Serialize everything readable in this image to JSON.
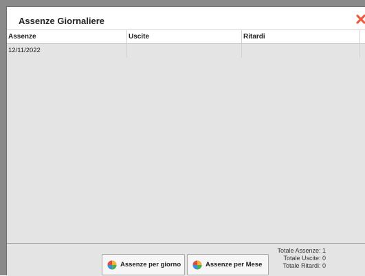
{
  "dialog": {
    "title": "Assenze Giornaliere"
  },
  "table": {
    "columns": [
      "Assenze",
      "Uscite",
      "Ritardi"
    ],
    "rows": [
      [
        "12/11/2022",
        "",
        ""
      ]
    ]
  },
  "footer": {
    "button_day_label": "Assenze per giorno",
    "button_month_label": "Assenze per Mese",
    "total_absences": "Totale Assenze: 1",
    "total_exits": "Totale Uscite: 0",
    "total_late": "Totale Ritardi: 0"
  },
  "icons": {
    "close": "close-icon",
    "chart": "pie-chart-icon"
  },
  "colors": {
    "close": "#ef5a3c",
    "backdrop": "#8a8a8a",
    "dialog_bg": "#e4e4e4"
  }
}
